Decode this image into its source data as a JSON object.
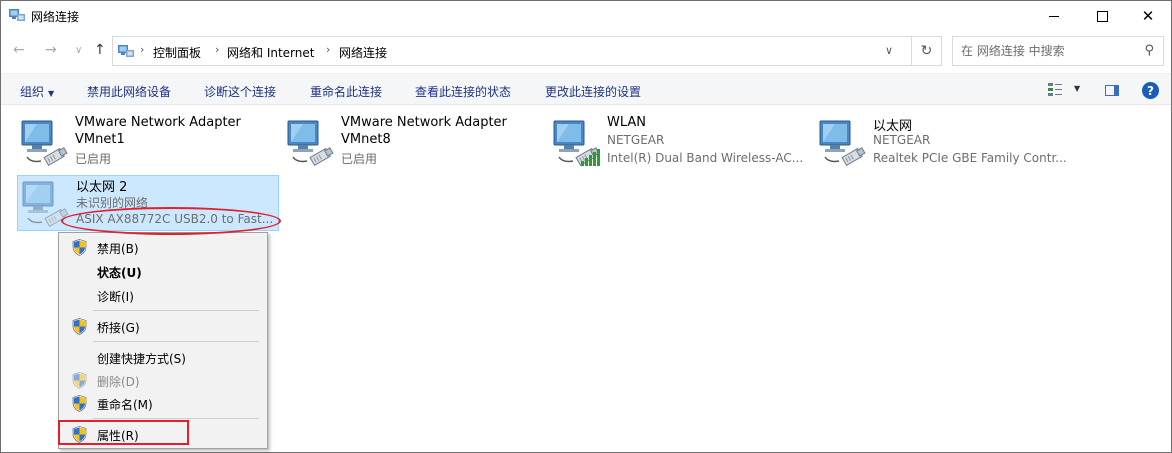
{
  "window": {
    "title": "网络连接",
    "close_glyph": "✕"
  },
  "address": {
    "breadcrumbs": [
      "控制面板",
      "网络和 Internet",
      "网络连接"
    ],
    "search_placeholder": "在 网络连接 中搜索"
  },
  "commands": {
    "organize": "组织",
    "disable_device": "禁用此网络设备",
    "diagnose": "诊断这个连接",
    "rename": "重命名此连接",
    "view_status": "查看此连接的状态",
    "change_settings": "更改此连接的设置",
    "help": "?"
  },
  "connections": [
    {
      "name": "VMware Network Adapter VMnet1",
      "name_line1": "VMware Network Adapter",
      "name_line2": "VMnet1",
      "status": "已启用",
      "device": ""
    },
    {
      "name": "VMware Network Adapter VMnet8",
      "name_line1": "VMware Network Adapter",
      "name_line2": "VMnet8",
      "status": "已启用",
      "device": ""
    },
    {
      "name": "WLAN",
      "status": "NETGEAR",
      "device": "Intel(R) Dual Band Wireless-AC..."
    },
    {
      "name": "以太网",
      "status": "NETGEAR",
      "device": "Realtek PCIe GBE Family Contr..."
    },
    {
      "name": "以太网 2",
      "status": "未识别的网络",
      "device": "ASIX AX88772C USB2.0 to Fast..."
    }
  ],
  "context_menu": {
    "items": [
      {
        "label": "禁用(B)",
        "shield": true,
        "bold": false,
        "disabled": false
      },
      {
        "label": "状态(U)",
        "shield": false,
        "bold": true,
        "disabled": false
      },
      {
        "label": "诊断(I)",
        "shield": false,
        "bold": false,
        "disabled": false
      },
      {
        "label": "桥接(G)",
        "shield": true,
        "bold": false,
        "disabled": false
      },
      {
        "label": "创建快捷方式(S)",
        "shield": false,
        "bold": false,
        "disabled": false
      },
      {
        "label": "删除(D)",
        "shield": true,
        "bold": false,
        "disabled": true
      },
      {
        "label": "重命名(M)",
        "shield": true,
        "bold": false,
        "disabled": false
      },
      {
        "label": "属性(R)",
        "shield": true,
        "bold": false,
        "disabled": false
      }
    ]
  },
  "colors": {
    "annotation": "#e0202a",
    "selection": "#cce8ff",
    "command_text": "#1e3287"
  }
}
